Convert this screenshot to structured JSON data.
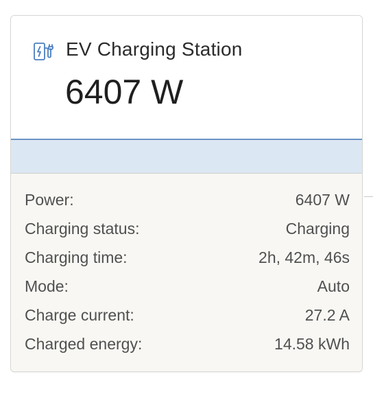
{
  "widget": {
    "title": "EV Charging Station",
    "power_display": "6407 W",
    "icon": "ev-charger-icon",
    "accent_color": "#4a7fc1",
    "bar_color": "#dce7f4"
  },
  "details": [
    {
      "label": "Power:",
      "value": "6407 W"
    },
    {
      "label": "Charging status:",
      "value": "Charging"
    },
    {
      "label": "Charging time:",
      "value": "2h, 42m, 46s"
    },
    {
      "label": "Mode:",
      "value": "Auto"
    },
    {
      "label": "Charge current:",
      "value": "27.2 A"
    },
    {
      "label": "Charged energy:",
      "value": "14.58 kWh"
    }
  ]
}
